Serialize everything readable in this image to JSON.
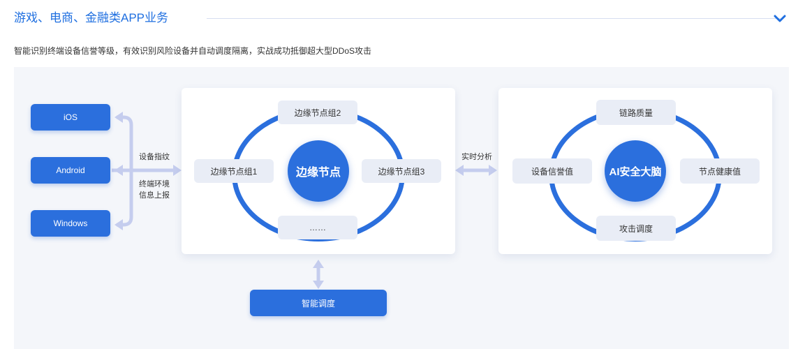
{
  "header": {
    "title": "游戏、电商、金融类APP业务",
    "subtitle": "智能识别终端设备信誉等级，有效识别风险设备并自动调度隔离，实战成功抵御超大型DDoS攻击",
    "toggle_icon": "chevron-down-icon"
  },
  "devices": [
    "iOS",
    "Android",
    "Windows"
  ],
  "labels": {
    "fingerprint": "设备指纹",
    "env_report_1": "终端环境",
    "env_report_2": "信息上报",
    "realtime": "实时分析"
  },
  "edge": {
    "center": "边缘节点",
    "top": "边缘节点组2",
    "left": "边缘节点组1",
    "right": "边缘节点组3",
    "bottom": "……"
  },
  "ai": {
    "center": "AI安全大脑",
    "top": "链路质量",
    "left": "设备信誉值",
    "right": "节点健康值",
    "bottom": "攻击调度"
  },
  "scheduling": "智能调度",
  "colors": {
    "accent": "#2b6fdd",
    "title": "#1f6fe0",
    "connector": "#c5cdee"
  }
}
